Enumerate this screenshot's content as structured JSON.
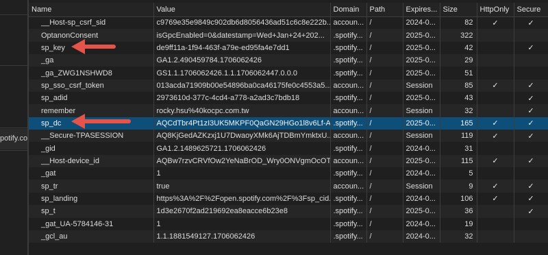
{
  "left_pane": {
    "text": "potify.co"
  },
  "headers": [
    "Name",
    "Value",
    "Domain",
    "Path",
    "Expires...",
    "Size",
    "HttpOnly",
    "Secure"
  ],
  "check_glyph": "✓",
  "rows": [
    {
      "name": "__Host-sp_csrf_sid",
      "value": "c9769e35e9849c902db6d8056436ad51c6c8e222b...",
      "domain": "accoun...",
      "path": "/",
      "expires": "2024-0...",
      "size": "82",
      "httponly": true,
      "secure": true
    },
    {
      "name": "OptanonConsent",
      "value": "isGpcEnabled=0&datestamp=Wed+Jan+24+202...",
      "domain": ".spotify...",
      "path": "/",
      "expires": "2025-0...",
      "size": "322",
      "httponly": false,
      "secure": false
    },
    {
      "name": "sp_key",
      "value": "de9ff11a-1f94-463f-a79e-ed95fa4e7dd1",
      "domain": ".spotify...",
      "path": "/",
      "expires": "2025-0...",
      "size": "42",
      "httponly": false,
      "secure": true
    },
    {
      "name": "_ga",
      "value": "GA1.2.490459784.1706062426",
      "domain": ".spotify...",
      "path": "/",
      "expires": "2025-0...",
      "size": "29",
      "httponly": false,
      "secure": false
    },
    {
      "name": "_ga_ZWG1NSHWD8",
      "value": "GS1.1.1706062426.1.1.1706062447.0.0.0",
      "domain": ".spotify...",
      "path": "/",
      "expires": "2025-0...",
      "size": "51",
      "httponly": false,
      "secure": false
    },
    {
      "name": "sp_sso_csrf_token",
      "value": "013acda71909b00e54896ba0ca46175fe0c4553a5...",
      "domain": "accoun...",
      "path": "/",
      "expires": "Session",
      "size": "85",
      "httponly": true,
      "secure": true
    },
    {
      "name": "sp_adid",
      "value": "2973610d-377c-4cd4-a778-a2ad3c7bdb18",
      "domain": ".spotify...",
      "path": "/",
      "expires": "2025-0...",
      "size": "43",
      "httponly": false,
      "secure": true
    },
    {
      "name": "remember",
      "value": "rocky.hsu%40kocpc.com.tw",
      "domain": "accoun...",
      "path": "/",
      "expires": "Session",
      "size": "32",
      "httponly": false,
      "secure": true
    },
    {
      "name": "sp_dc",
      "value": "AQCdTbr4Pt1zI3UK5MKPF0QaGN29HGo1l8v6Lf-A...",
      "domain": ".spotify...",
      "path": "/",
      "expires": "2025-0...",
      "size": "165",
      "httponly": true,
      "secure": true,
      "selected": true
    },
    {
      "name": "__Secure-TPASESSION",
      "value": "AQ8KjGedAZKzxj1U7DwaoyXMk6AjTDBmYmktxU...",
      "domain": "accoun...",
      "path": "/",
      "expires": "Session",
      "size": "119",
      "httponly": true,
      "secure": true
    },
    {
      "name": "_gid",
      "value": "GA1.2.1489625721.1706062426",
      "domain": ".spotify...",
      "path": "/",
      "expires": "2024-0...",
      "size": "31",
      "httponly": false,
      "secure": false
    },
    {
      "name": "__Host-device_id",
      "value": "AQBw7rzvCRVfOw2YeNaBrOD_Wry0ONVgmOcOT...",
      "domain": "accoun...",
      "path": "/",
      "expires": "2025-0...",
      "size": "115",
      "httponly": true,
      "secure": true
    },
    {
      "name": "_gat",
      "value": "1",
      "domain": ".spotify...",
      "path": "/",
      "expires": "2024-0...",
      "size": "5",
      "httponly": false,
      "secure": false
    },
    {
      "name": "sp_tr",
      "value": "true",
      "domain": "accoun...",
      "path": "/",
      "expires": "Session",
      "size": "9",
      "httponly": true,
      "secure": true
    },
    {
      "name": "sp_landing",
      "value": "https%3A%2F%2Fopen.spotify.com%2F%3Fsp_cid...",
      "domain": ".spotify...",
      "path": "/",
      "expires": "2024-0...",
      "size": "106",
      "httponly": true,
      "secure": true
    },
    {
      "name": "sp_t",
      "value": "1d3e2670f2ad219692ea8eacce6b23e8",
      "domain": ".spotify...",
      "path": "/",
      "expires": "2025-0...",
      "size": "36",
      "httponly": false,
      "secure": true
    },
    {
      "name": "_gat_UA-5784146-31",
      "value": "1",
      "domain": ".spotify...",
      "path": "/",
      "expires": "2024-0...",
      "size": "19",
      "httponly": false,
      "secure": false
    },
    {
      "name": "_gcl_au",
      "value": "1.1.1881549127.1706062426",
      "domain": ".spotify...",
      "path": "/",
      "expires": "2024-0...",
      "size": "32",
      "httponly": false,
      "secure": false
    }
  ],
  "annotation_color": "#e5544b"
}
